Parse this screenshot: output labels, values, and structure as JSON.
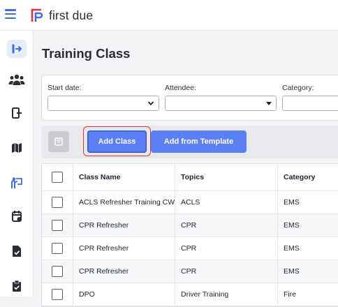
{
  "app": {
    "name": "first due",
    "brand_color": "#3b6fe0",
    "accent_red": "#e0303a"
  },
  "sidebar": {
    "items": [
      {
        "icon": "collapse-expand-icon"
      },
      {
        "icon": "people-icon"
      },
      {
        "icon": "exit-door-icon"
      },
      {
        "icon": "map-icon"
      },
      {
        "icon": "training-icon",
        "active": true
      },
      {
        "icon": "calendar-icon"
      },
      {
        "icon": "document-check-icon"
      },
      {
        "icon": "clipboard-check-icon"
      }
    ]
  },
  "page": {
    "title": "Training Class"
  },
  "filters": {
    "start_date": {
      "label": "Start date:",
      "value": ""
    },
    "attendee": {
      "label": "Attendee:",
      "value": ""
    },
    "category": {
      "label": "Category:",
      "value": ""
    }
  },
  "toolbar": {
    "add_class_label": "Add Class",
    "add_from_template_label": "Add from Template"
  },
  "table": {
    "columns": [
      "Class Name",
      "Topics",
      "Category"
    ],
    "rows": [
      {
        "class_name": "ACLS Refresher Training CW",
        "topics": "ACLS",
        "category": "EMS"
      },
      {
        "class_name": "CPR Refresher",
        "topics": "CPR",
        "category": "EMS"
      },
      {
        "class_name": "CPR Refresher",
        "topics": "CPR",
        "category": "EMS"
      },
      {
        "class_name": "CPR Refresher",
        "topics": "CPR",
        "category": "EMS"
      },
      {
        "class_name": "DPO",
        "topics": "Driver Training",
        "category": "Fire"
      }
    ]
  }
}
